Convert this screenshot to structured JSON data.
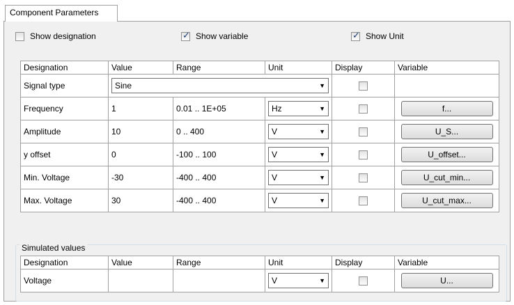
{
  "tab": {
    "label": "Component Parameters"
  },
  "options": {
    "show_designation": {
      "label": "Show designation",
      "checked": false
    },
    "show_variable": {
      "label": "Show variable",
      "checked": true
    },
    "show_unit": {
      "label": "Show Unit",
      "checked": true
    }
  },
  "params": {
    "headers": [
      "Designation",
      "Value",
      "Range",
      "Unit",
      "Display",
      "Variable"
    ],
    "signal_type": {
      "designation": "Signal type",
      "value": "Sine"
    },
    "rows": [
      {
        "designation": "Frequency",
        "value": "1",
        "range": "0.01 .. 1E+05",
        "unit": "Hz",
        "variable": "f..."
      },
      {
        "designation": "Amplitude",
        "value": "10",
        "range": "0 .. 400",
        "unit": "V",
        "variable": "U_S..."
      },
      {
        "designation": "y offset",
        "value": "0",
        "range": "-100 .. 100",
        "unit": "V",
        "variable": "U_offset..."
      },
      {
        "designation": "Min. Voltage",
        "value": "-30",
        "range": "-400 .. 400",
        "unit": "V",
        "variable": "U_cut_min..."
      },
      {
        "designation": "Max. Voltage",
        "value": "30",
        "range": "-400 .. 400",
        "unit": "V",
        "variable": "U_cut_max..."
      }
    ]
  },
  "simulated": {
    "title": "Simulated values",
    "headers": [
      "Designation",
      "Value",
      "Range",
      "Unit",
      "Display",
      "Variable"
    ],
    "rows": [
      {
        "designation": "Voltage",
        "value": "",
        "range": "",
        "unit": "V",
        "variable": "U..."
      }
    ]
  }
}
